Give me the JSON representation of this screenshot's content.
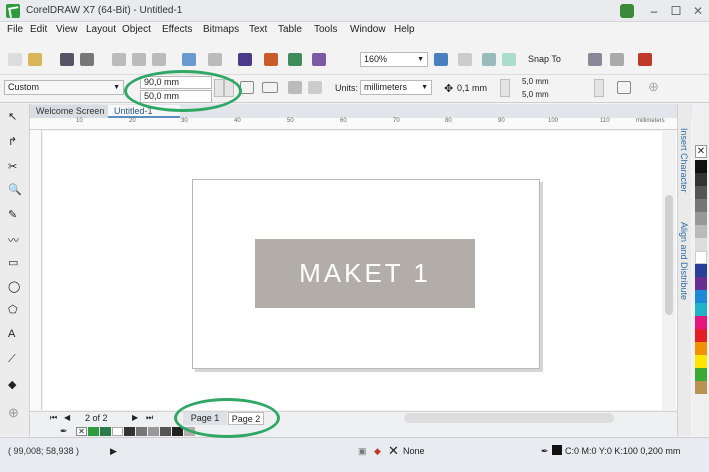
{
  "window": {
    "title": "CorelDRAW X7 (64-Bit) - Untitled-1",
    "minimize": "–",
    "maximize": "☐",
    "close": "✕"
  },
  "menu": [
    "File",
    "Edit",
    "View",
    "Layout",
    "Object",
    "Effects",
    "Bitmaps",
    "Text",
    "Table",
    "Tools",
    "Window",
    "Help"
  ],
  "toolbar": {
    "zoom": "160%",
    "snap_to": "Snap To"
  },
  "property_bar": {
    "preset": "Custom",
    "width": "90,0 mm",
    "height": "50,0 mm",
    "units_label": "Units:",
    "units_value": "millimeters",
    "nudge": "0,1 mm",
    "dup_x": "5,0 mm",
    "dup_y": "5,0 mm"
  },
  "doc_tabs": [
    "Welcome Screen",
    "Untitled-1"
  ],
  "ruler": {
    "units": "millimeters",
    "ticks": [
      "10",
      "20",
      "30",
      "40",
      "50",
      "60",
      "70",
      "80",
      "90",
      "100",
      "110"
    ]
  },
  "page_content": {
    "text": "MAKET 1"
  },
  "page_nav": {
    "count": "2 of 2",
    "pages": [
      "Page 1",
      "Page 2"
    ]
  },
  "dockers": [
    "Insert Character",
    "Align and Distribute"
  ],
  "status": {
    "coords": "( 99,008; 58,938 )",
    "fill": "None",
    "outline": "C:0 M:0 Y:0 K:100 0,200 mm"
  },
  "colors": {
    "accent": "#2fa866",
    "page_text_bg": "#b2ada9"
  },
  "icons": [
    "corel-app-icon",
    "pick-tool-icon",
    "shape-tool-icon",
    "zoom-icon",
    "freehand-icon",
    "rectangle-tool-icon",
    "ellipse-tool-icon",
    "polygon-tool-icon",
    "text-tool-icon",
    "fill-icon"
  ]
}
